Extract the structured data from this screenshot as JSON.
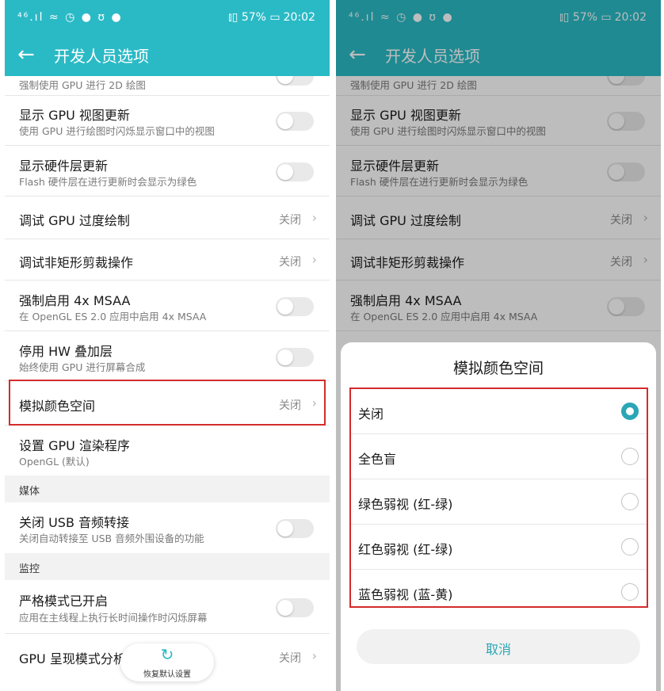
{
  "status_bar": {
    "left_icons": "⁴⁶.ıl ≈ ◷ ● ʊ ●",
    "battery": "⫾▯ 57% ▭",
    "time": "20:02"
  },
  "app_bar": {
    "back_icon": "←",
    "title": "开发人员选项"
  },
  "list": {
    "partial_top": "强制使用 GPU 进行 2D 绘图",
    "items": [
      {
        "title": "显示 GPU 视图更新",
        "subtitle": "使用 GPU 进行绘图时闪烁显示窗口中的视图"
      },
      {
        "title": "显示硬件层更新",
        "subtitle": "Flash 硬件层在进行更新时会显示为绿色"
      },
      {
        "title": "调试 GPU 过度绘制",
        "value": "关闭"
      },
      {
        "title": "调试非矩形剪裁操作",
        "value": "关闭"
      },
      {
        "title": "强制启用 4x MSAA",
        "subtitle": "在 OpenGL ES 2.0 应用中启用 4x MSAA"
      },
      {
        "title": "停用 HW 叠加层",
        "subtitle": "始终使用 GPU 进行屏幕合成"
      },
      {
        "title": "模拟颜色空间",
        "value": "关闭"
      },
      {
        "title": "设置 GPU 渲染程序",
        "subtitle": "OpenGL (默认)"
      },
      {
        "title": "关闭 USB 音频转接",
        "subtitle": "关闭自动转接至 USB 音频外围设备的功能"
      },
      {
        "title": "严格模式已开启",
        "subtitle": "应用在主线程上执行长时间操作时闪烁屏幕"
      },
      {
        "title": "GPU 呈现模式分析",
        "value": "关闭"
      }
    ],
    "sections": [
      "媒体",
      "监控"
    ],
    "chevron_icon": "›"
  },
  "restore_fab": {
    "icon": "↻",
    "label": "恢复默认设置"
  },
  "dialog": {
    "title": "模拟颜色空间",
    "options": [
      {
        "label": "关闭",
        "selected": true
      },
      {
        "label": "全色盲",
        "selected": false
      },
      {
        "label": "绿色弱视 (红-绿)",
        "selected": false
      },
      {
        "label": "红色弱视 (红-绿)",
        "selected": false
      },
      {
        "label": "蓝色弱视 (蓝-黄)",
        "selected": false
      }
    ],
    "cancel_label": "取消"
  },
  "colors": {
    "accent": "#2abac6",
    "highlight": "#d42b2b"
  }
}
